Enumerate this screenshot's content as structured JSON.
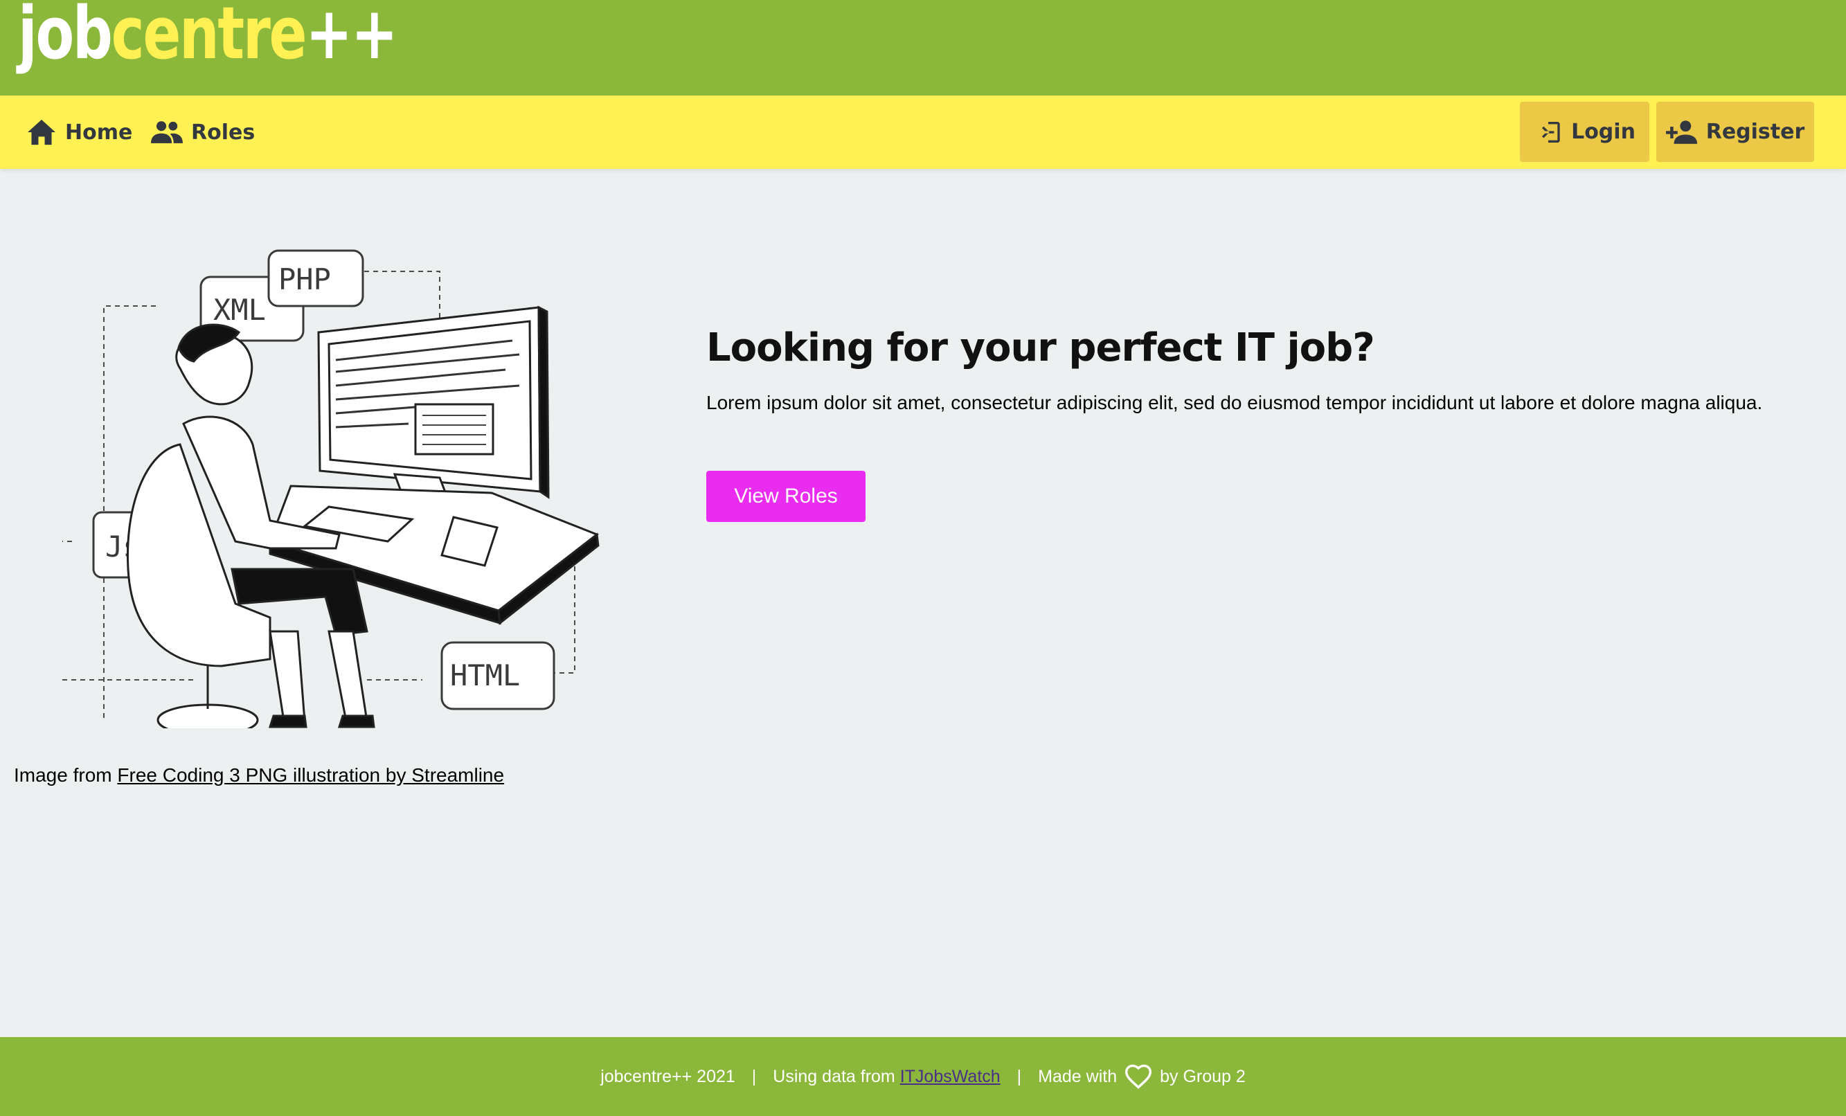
{
  "brand": {
    "part1": "job",
    "part2": "centre",
    "part3": "++"
  },
  "nav": {
    "home": "Home",
    "roles": "Roles",
    "login": "Login",
    "register": "Register"
  },
  "illustration": {
    "tags": [
      "XML",
      "PHP",
      "Js",
      "HTML"
    ]
  },
  "credit": {
    "prefix": "Image from ",
    "link": "Free Coding 3 PNG illustration by Streamline"
  },
  "hero": {
    "title": "Looking for your perfect IT job?",
    "body": "Lorem ipsum dolor sit amet, consectetur adipiscing elit, sed do eiusmod tempor incididunt ut labore et dolore magna aliqua.",
    "button": "View Roles"
  },
  "footer": {
    "copyright": "jobcentre++ 2021",
    "sep": "|",
    "data_prefix": "Using data from ",
    "data_link": "ITJobsWatch",
    "made_with": "Made with",
    "by": "by Group 2"
  },
  "colors": {
    "brand_green": "#8bb73a",
    "nav_yellow": "#fff153",
    "button_gold": "#ebc946",
    "cta_magenta": "#ea2cf0",
    "background": "#edf0f1"
  },
  "icons": [
    "home-icon",
    "people-icon",
    "login-icon",
    "person-add-icon",
    "heart-icon"
  ]
}
